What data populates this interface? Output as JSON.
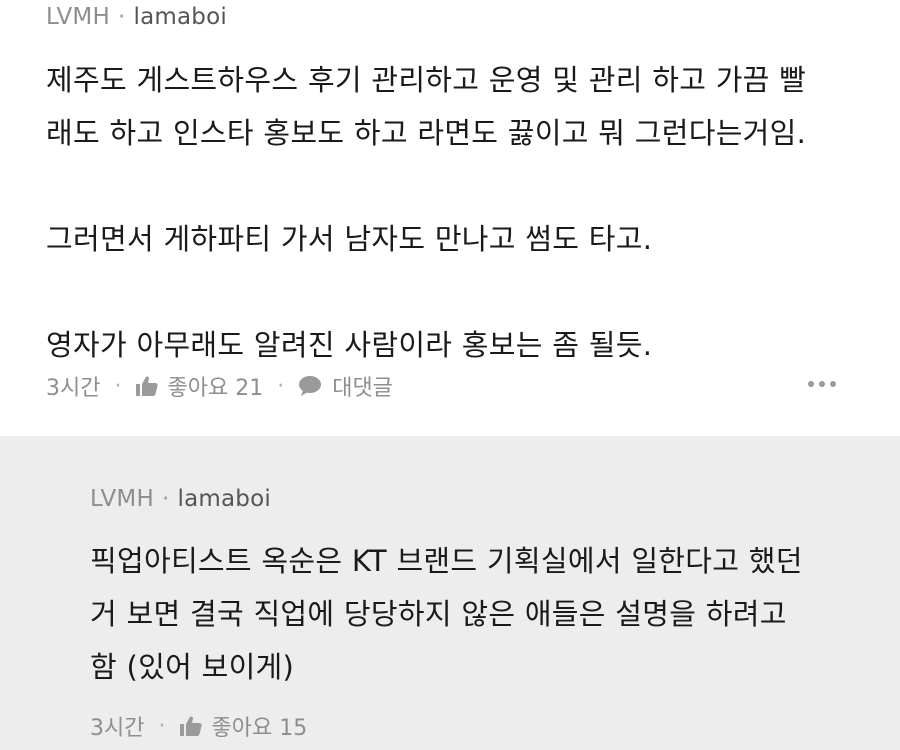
{
  "comment": {
    "author": "LVMH",
    "separator": "·",
    "username": "lamaboi",
    "lines": [
      "제주도 게스트하우스 후기 관리하고 운영 및 관리 하고 가끔 빨",
      "래도 하고 인스타 홍보도 하고 라면도 끓이고 뭐 그런다는거임.",
      "",
      "그러면서 게하파티 가서 남자도 만나고 썸도 타고.",
      "",
      "영자가 아무래도 알려진 사람이라 홍보는 좀 될듯."
    ],
    "time": "3시간",
    "like_label": "좋아요 21",
    "reply_label": "대댓글",
    "meta_separator": "·"
  },
  "reply": {
    "author": "LVMH",
    "separator": "·",
    "username": "lamaboi",
    "lines": [
      "픽업아티스트 옥순은 KT 브랜드 기획실에서 일한다고 했던",
      "거 보면 결국 직업에 당당하지 않은 애들은 설명을 하려고",
      "함 (있어 보이게)"
    ],
    "time": "3시간",
    "like_label": "좋아요 15",
    "meta_separator": "·"
  },
  "colors": {
    "reply_background": "#ededed",
    "meta_gray": "#8e8e8e",
    "text": "#1a1a1a"
  },
  "icons": [
    "thumbs-up-icon",
    "speech-bubble-icon",
    "more-dots-icon"
  ]
}
